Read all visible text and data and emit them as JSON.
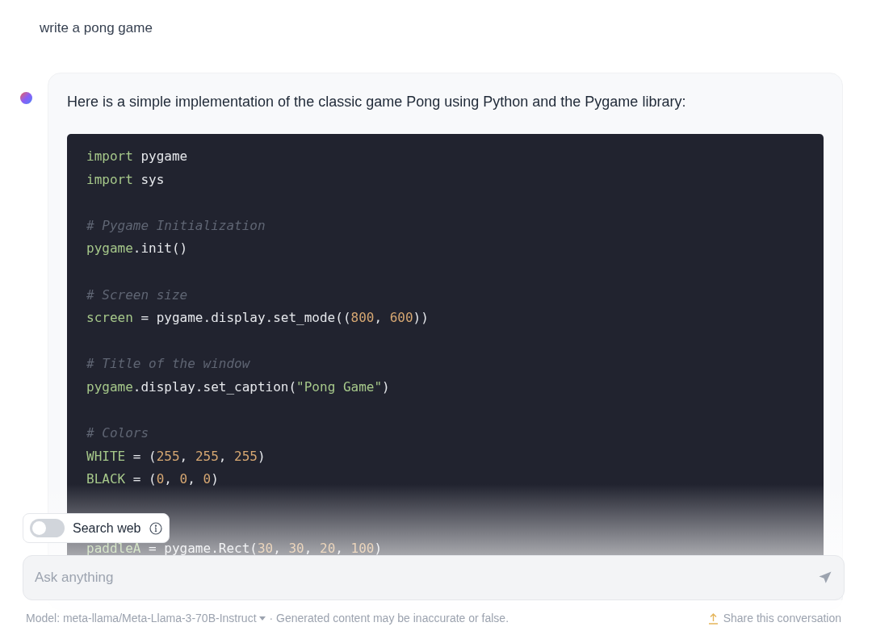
{
  "user_message": "write a pong game",
  "reply": {
    "intro": "Here is a simple implementation of the classic game Pong using Python and the Pygame library:",
    "code_lines": [
      {
        "kind": "code",
        "tokens": [
          {
            "kind": "keyword",
            "text": "import"
          },
          {
            "kind": "plain",
            "text": " pygame"
          }
        ]
      },
      {
        "kind": "code",
        "tokens": [
          {
            "kind": "keyword",
            "text": "import"
          },
          {
            "kind": "plain",
            "text": " sys"
          }
        ]
      },
      {
        "kind": "blank"
      },
      {
        "kind": "code",
        "tokens": [
          {
            "kind": "comment",
            "text": "# Pygame Initialization"
          }
        ]
      },
      {
        "kind": "code",
        "tokens": [
          {
            "kind": "name",
            "text": "pygame"
          },
          {
            "kind": "plain",
            "text": ".init()"
          }
        ]
      },
      {
        "kind": "blank"
      },
      {
        "kind": "code",
        "tokens": [
          {
            "kind": "comment",
            "text": "# Screen size"
          }
        ]
      },
      {
        "kind": "code",
        "tokens": [
          {
            "kind": "name",
            "text": "screen"
          },
          {
            "kind": "plain",
            "text": " = pygame.display.set_mode(("
          },
          {
            "kind": "number",
            "text": "800"
          },
          {
            "kind": "plain",
            "text": ", "
          },
          {
            "kind": "number",
            "text": "600"
          },
          {
            "kind": "plain",
            "text": "))"
          }
        ]
      },
      {
        "kind": "blank"
      },
      {
        "kind": "code",
        "tokens": [
          {
            "kind": "comment",
            "text": "# Title of the window"
          }
        ]
      },
      {
        "kind": "code",
        "tokens": [
          {
            "kind": "name",
            "text": "pygame"
          },
          {
            "kind": "plain",
            "text": ".display.set_caption("
          },
          {
            "kind": "string",
            "text": "\"Pong Game\""
          },
          {
            "kind": "plain",
            "text": ")"
          }
        ]
      },
      {
        "kind": "blank"
      },
      {
        "kind": "code",
        "tokens": [
          {
            "kind": "comment",
            "text": "# Colors"
          }
        ]
      },
      {
        "kind": "code",
        "tokens": [
          {
            "kind": "name",
            "text": "WHITE"
          },
          {
            "kind": "plain",
            "text": " = ("
          },
          {
            "kind": "number",
            "text": "255"
          },
          {
            "kind": "plain",
            "text": ", "
          },
          {
            "kind": "number",
            "text": "255"
          },
          {
            "kind": "plain",
            "text": ", "
          },
          {
            "kind": "number",
            "text": "255"
          },
          {
            "kind": "plain",
            "text": ")"
          }
        ]
      },
      {
        "kind": "code",
        "tokens": [
          {
            "kind": "name",
            "text": "BLACK"
          },
          {
            "kind": "plain",
            "text": " = ("
          },
          {
            "kind": "number",
            "text": "0"
          },
          {
            "kind": "plain",
            "text": ", "
          },
          {
            "kind": "number",
            "text": "0"
          },
          {
            "kind": "plain",
            "text": ", "
          },
          {
            "kind": "number",
            "text": "0"
          },
          {
            "kind": "plain",
            "text": ")"
          }
        ]
      },
      {
        "kind": "blank"
      },
      {
        "kind": "blank"
      },
      {
        "kind": "code",
        "tokens": [
          {
            "kind": "name",
            "text": "paddleA"
          },
          {
            "kind": "plain",
            "text": " = pygame.Rect("
          },
          {
            "kind": "number",
            "text": "30"
          },
          {
            "kind": "plain",
            "text": ", "
          },
          {
            "kind": "number",
            "text": "30"
          },
          {
            "kind": "plain",
            "text": ", "
          },
          {
            "kind": "number",
            "text": "20"
          },
          {
            "kind": "plain",
            "text": ", "
          },
          {
            "kind": "number",
            "text": "100"
          },
          {
            "kind": "plain",
            "text": ")"
          }
        ]
      }
    ]
  },
  "search_web": {
    "label": "Search web",
    "on": false
  },
  "input": {
    "placeholder": "Ask anything"
  },
  "footer": {
    "model": "Model: meta-llama/Meta-Llama-3-70B-Instruct",
    "disclaimer": "· Generated content may be inaccurate or false.",
    "share": "Share this conversation"
  }
}
